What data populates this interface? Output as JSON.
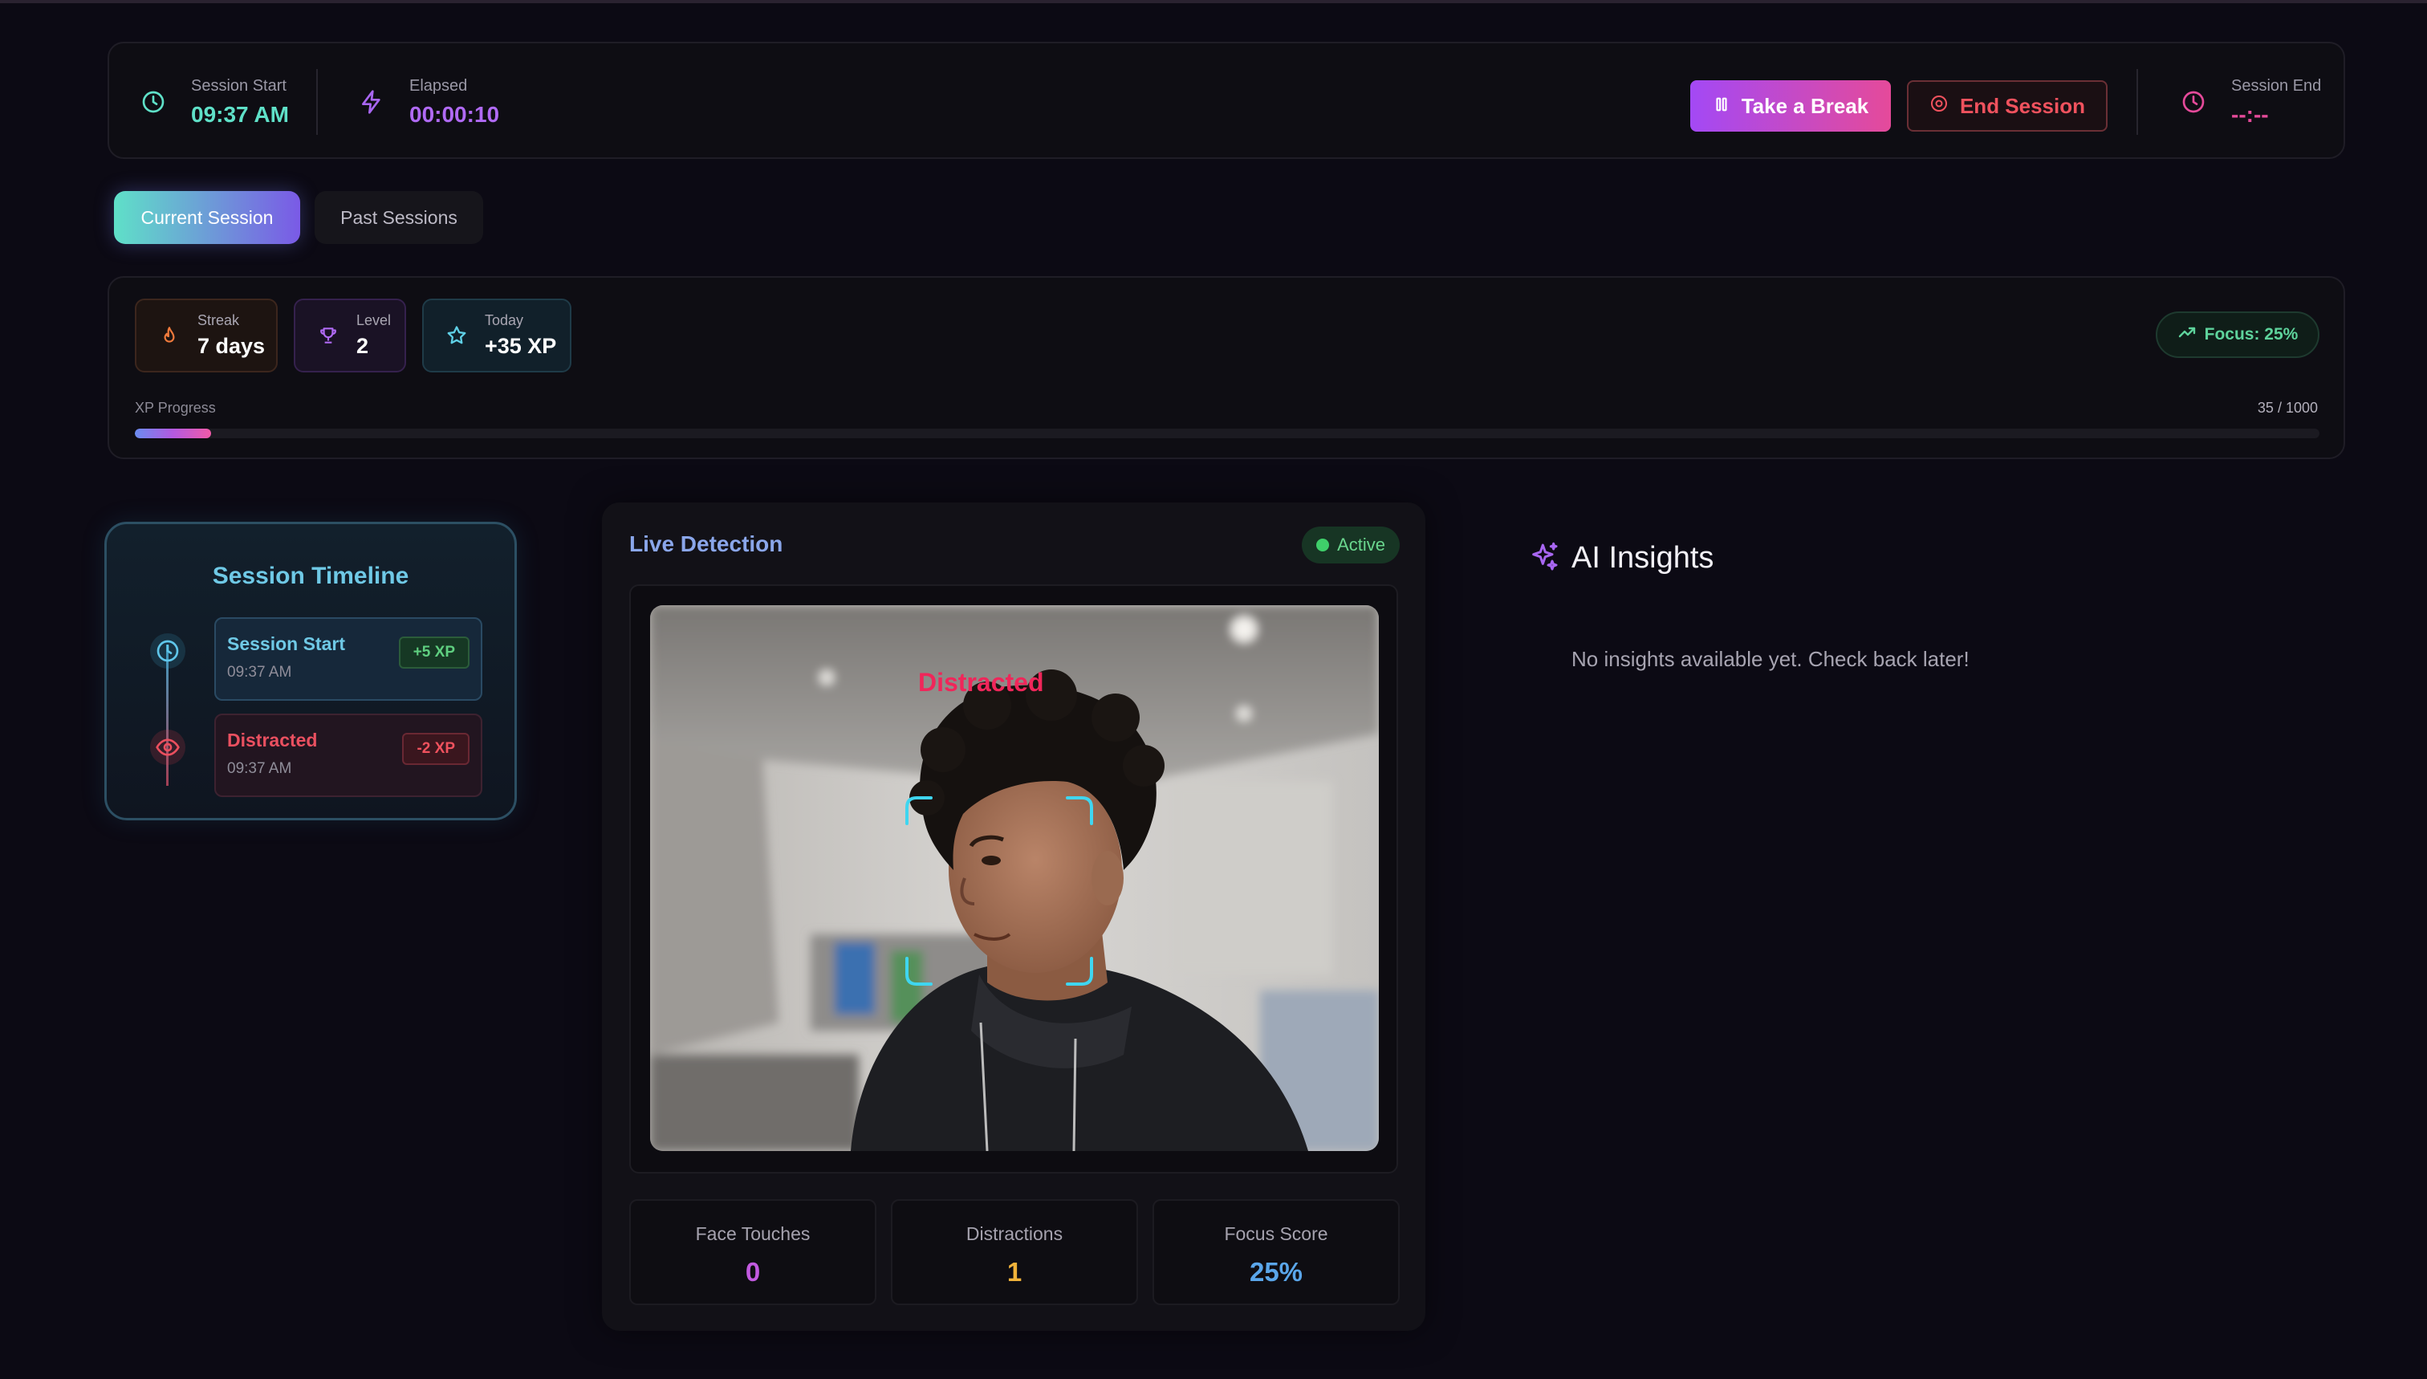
{
  "header": {
    "session_start_label": "Session Start",
    "session_start_value": "09:37 AM",
    "elapsed_label": "Elapsed",
    "elapsed_value": "00:00:10",
    "break_button": "Take a Break",
    "end_button": "End Session",
    "session_end_label": "Session End",
    "session_end_value": "--:--"
  },
  "tabs": [
    {
      "label": "Current Session",
      "active": true
    },
    {
      "label": "Past Sessions",
      "active": false
    }
  ],
  "stats": {
    "streak_label": "Streak",
    "streak_value": "7 days",
    "level_label": "Level",
    "level_value": "2",
    "today_label": "Today",
    "today_value": "+35 XP",
    "focus_badge": "Focus: 25%",
    "xp_label": "XP Progress",
    "xp_count": "35 / 1000",
    "xp_current": 35,
    "xp_max": 1000
  },
  "timeline": {
    "title": "Session Timeline",
    "events": [
      {
        "title": "Session Start",
        "time": "09:37 AM",
        "xp": "+5 XP"
      },
      {
        "title": "Distracted",
        "time": "09:37 AM",
        "xp": "-2 XP"
      }
    ]
  },
  "live": {
    "title": "Live Detection",
    "status": "Active",
    "overlay_label": "Distracted",
    "metrics": [
      {
        "label": "Face Touches",
        "value": "0"
      },
      {
        "label": "Distractions",
        "value": "1"
      },
      {
        "label": "Focus Score",
        "value": "25%"
      }
    ]
  },
  "insights": {
    "title": "AI Insights",
    "empty": "No insights available yet. Check back later!"
  },
  "colors": {
    "accent_teal": "#5fe0c8",
    "accent_purple": "#a349f5",
    "accent_pink": "#e54a9a",
    "danger": "#f0525e",
    "success": "#5ed39c",
    "background": "#0c0a14"
  },
  "icons": {
    "session_start": "clock-icon",
    "elapsed": "lightning-icon",
    "break": "pause-icon",
    "end": "stop-circle-icon",
    "session_end": "clock-icon",
    "streak": "flame-icon",
    "level": "trophy-icon",
    "today": "star-icon",
    "focus": "trending-up-icon",
    "timeline_start": "clock-icon",
    "timeline_distracted": "eye-icon",
    "insights": "sparkles-icon"
  }
}
